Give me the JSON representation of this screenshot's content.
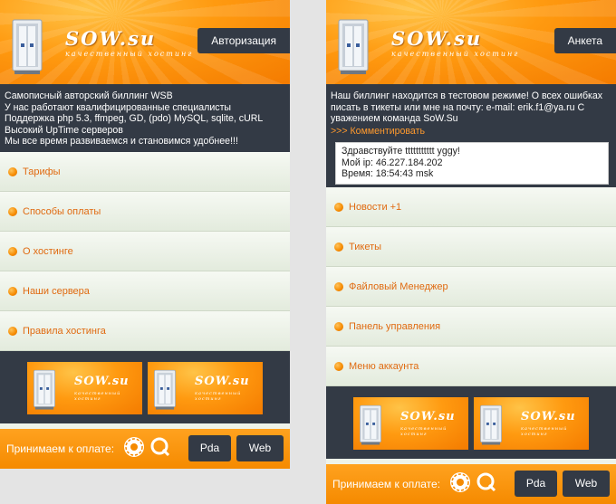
{
  "brand": {
    "logo": "SOW.su",
    "tagline": "качественный хостинг"
  },
  "left": {
    "header_button": "Авторизация",
    "info_lines": [
      "Самописный авторский биллинг WSB",
      "У нас работают квалифицированные специалисты",
      "Поддержка php 5.3, ffmpeg, GD, (pdo) MySQL, sqlite, cURL",
      "Высокий UpTime серверов",
      "Мы все время развиваемся и становимся удобнее!!!"
    ],
    "menu": [
      {
        "label": "Тарифы"
      },
      {
        "label": "Способы оплаты"
      },
      {
        "label": "О хостинге"
      },
      {
        "label": "Наши сервера"
      },
      {
        "label": "Правила хостинга"
      }
    ],
    "footer": {
      "pay_label": "Принимаем к оплате:",
      "pda": "Pda",
      "web": "Web"
    }
  },
  "right": {
    "header_button": "Анкета",
    "info_lines": [
      "Наш биллинг находится в тестовом режиме! О всех ошибках",
      "писать в тикеты или мне на почту: e-mail: erik.f1@ya.ru С",
      "уважением команда SoW.Su"
    ],
    "comment_link": ">>> Комментировать",
    "greeting": {
      "hello": "Здравствуйте ttttttttttt yggy!",
      "ip": "Мой ip: 46.227.184.202",
      "time": "Время: 18:54:43 msk"
    },
    "menu": [
      {
        "label": "Новости +1"
      },
      {
        "label": "Тикеты"
      },
      {
        "label": "Файловый Менеджер"
      },
      {
        "label": "Панель управления"
      },
      {
        "label": "Меню аккаунта"
      }
    ],
    "footer": {
      "pay_label": "Принимаем к оплате:",
      "pda": "Pda",
      "web": "Web"
    }
  },
  "colors": {
    "accent": "#f58a00",
    "dark": "#333a45",
    "menu_text": "#e06a10",
    "link": "#ff9a2e"
  },
  "icons": [
    "server-icon",
    "webmoney-icon",
    "qiwi-icon",
    "bullet-icon"
  ]
}
